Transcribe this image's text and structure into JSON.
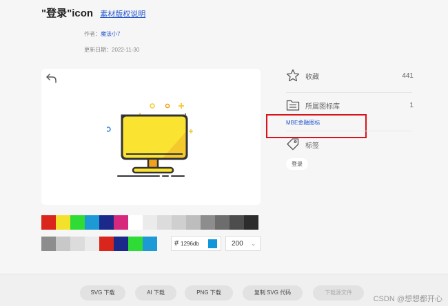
{
  "title": {
    "name": "\"登录\"icon",
    "copyright_link": "素材版权说明"
  },
  "meta": {
    "author_label": "作者：",
    "author_name": "魔法小7",
    "date_label": "更新日期：",
    "date_value": "2022-11-30"
  },
  "icons": {
    "undo": "undo-icon",
    "star": "star-icon",
    "library": "library-icon",
    "tag": "tag-icon"
  },
  "stats": {
    "favorites_label": "收藏",
    "favorites_count": "441",
    "library_label": "所属图标库",
    "library_count": "1",
    "library_name": "MBE金融图标",
    "tags_label": "标签",
    "tag_chip": "登录"
  },
  "palette_row1": [
    "#d9251c",
    "#f4e12c",
    "#2fdc35",
    "#1d9ad6",
    "#1b2a8a",
    "#d6287d",
    "#ffffff",
    "#ebebeb",
    "#dcdcdc",
    "#cfcfcf",
    "#bdbdbd",
    "#8d8d8d",
    "#6d6d6d",
    "#4d4d4d",
    "#2c2c2c"
  ],
  "palette_row2": [
    "#8d8d8d",
    "#c8c8c8",
    "#dcdcdc",
    "#ebebeb",
    "#d9251c",
    "#1b2a8a",
    "#2fdc35",
    "#1d9ad6"
  ],
  "color_input": {
    "hash": "#",
    "value": "1296db",
    "chip_color": "#1296db"
  },
  "size_select": {
    "value": "200"
  },
  "downloads": {
    "svg": "SVG 下载",
    "ai": "AI 下载",
    "png": "PNG 下载",
    "copy_svg": "复制 SVG 代码",
    "source": "下载源文件"
  },
  "watermark": "CSDN @想想都开心"
}
